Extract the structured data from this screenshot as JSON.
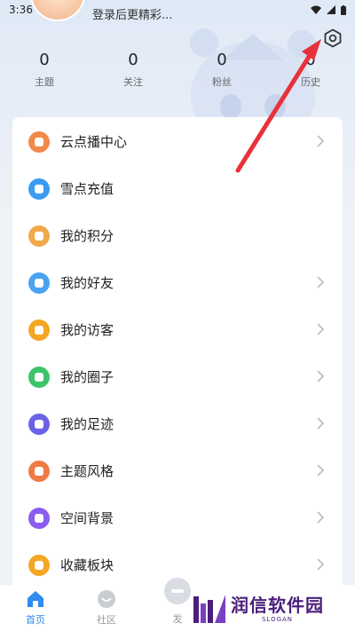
{
  "status_bar": {
    "time": "3:36"
  },
  "user": {
    "login_hint": "登录后更精彩..."
  },
  "stats": [
    {
      "value": "0",
      "label": "主题"
    },
    {
      "value": "0",
      "label": "关注"
    },
    {
      "value": "0",
      "label": "粉丝"
    },
    {
      "value": "0",
      "label": "历史"
    }
  ],
  "menu": [
    {
      "label": "云点播中心",
      "color": "#f08a4b",
      "chevron": true
    },
    {
      "label": "雪点充值",
      "color": "#3a9bf0",
      "chevron": false
    },
    {
      "label": "我的积分",
      "color": "#f0a94b",
      "chevron": false
    },
    {
      "label": "我的好友",
      "color": "#4aa3f0",
      "chevron": true
    },
    {
      "label": "我的访客",
      "color": "#f5a623",
      "chevron": true
    },
    {
      "label": "我的圈子",
      "color": "#3cc46a",
      "chevron": true
    },
    {
      "label": "我的足迹",
      "color": "#6a63e8",
      "chevron": true
    },
    {
      "label": "主题风格",
      "color": "#f07a45",
      "chevron": true
    },
    {
      "label": "空间背景",
      "color": "#8a5cf0",
      "chevron": true
    },
    {
      "label": "收藏板块",
      "color": "#f5a623",
      "chevron": true
    }
  ],
  "bottom_nav": {
    "home": "首页",
    "community": "社区",
    "post": "发"
  },
  "watermark": {
    "main": "润信软件园",
    "sub": "SLOGAN"
  },
  "colors": {
    "accent": "#2f8bf0",
    "arrow": "#e8313a"
  }
}
